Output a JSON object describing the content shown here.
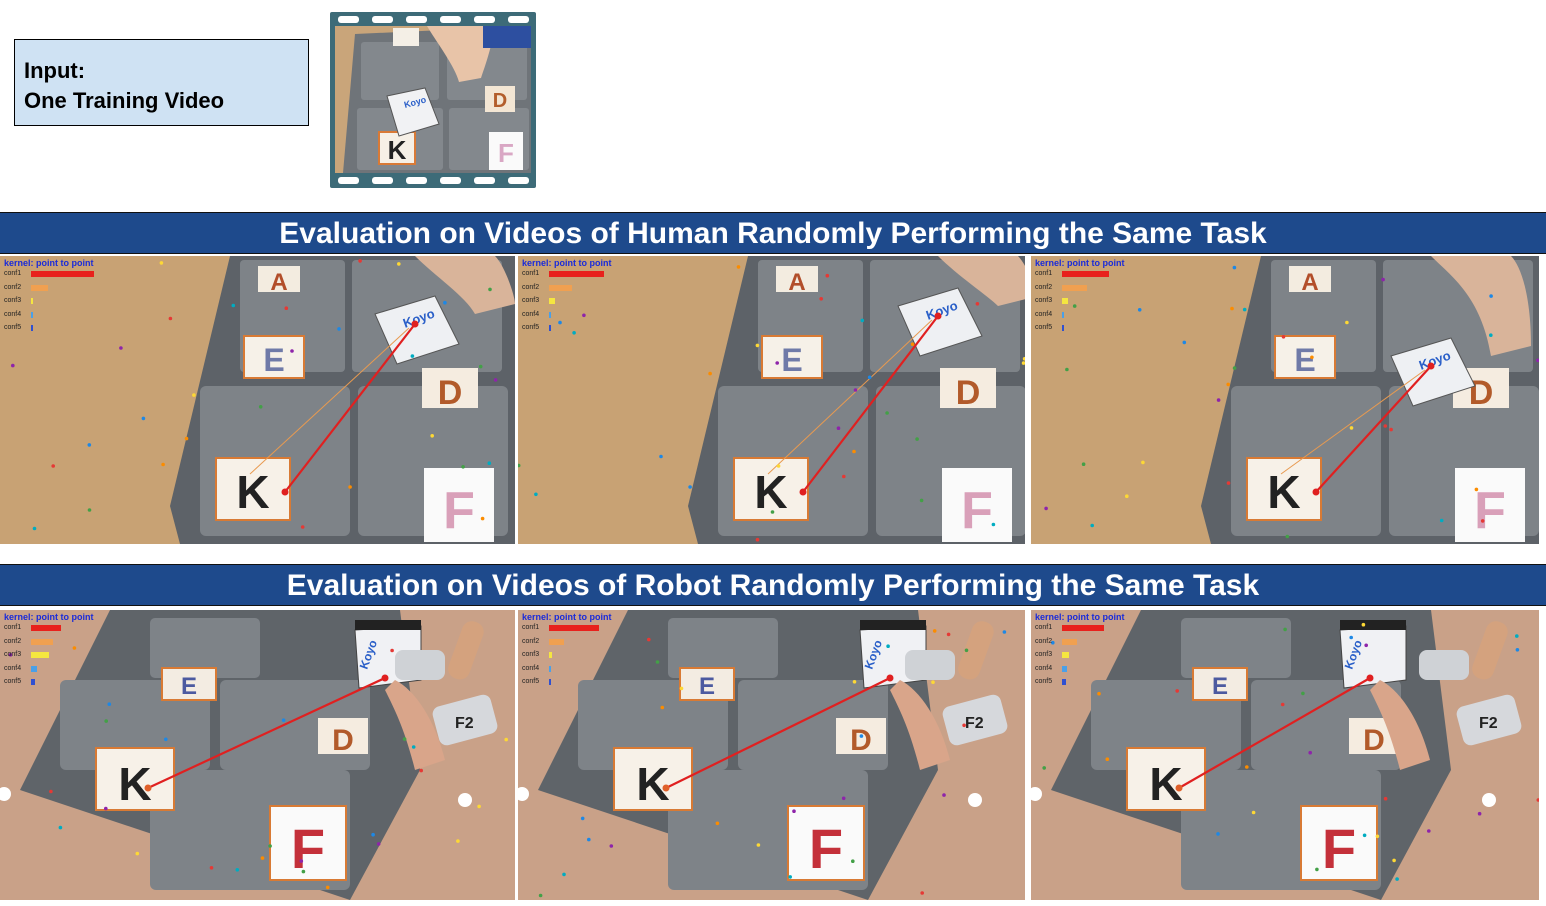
{
  "input_box": {
    "line1": "Input:",
    "line2": "One Training Video"
  },
  "banners": {
    "human": "Evaluation on Videos of Human Randomly Performing the Same Task",
    "robot": "Evaluation on Videos of Robot Randomly Performing the Same Task"
  },
  "kernel_label": "kernel: point to point",
  "confidence_labels": [
    "conf1",
    "conf2",
    "conf3",
    "conf4",
    "conf5"
  ],
  "bar_colors": [
    "#e8211c",
    "#f0a050",
    "#f5e640",
    "#4aa0e8",
    "#3050d0"
  ],
  "human_panels": [
    {
      "conf_fractions": [
        0.79,
        0.21,
        0.005,
        0.005,
        0.003
      ]
    },
    {
      "conf_fractions": [
        0.69,
        0.29,
        0.08,
        0.012,
        0.006
      ]
    },
    {
      "conf_fractions": [
        0.59,
        0.31,
        0.07,
        0.008,
        0.002
      ]
    }
  ],
  "robot_panels": [
    {
      "conf_fractions": [
        0.38,
        0.27,
        0.22,
        0.07,
        0.05
      ]
    },
    {
      "conf_fractions": [
        0.62,
        0.19,
        0.04,
        0.03,
        0.01
      ]
    },
    {
      "conf_fractions": [
        0.53,
        0.19,
        0.09,
        0.06,
        0.05
      ]
    }
  ],
  "card_letters": [
    "A",
    "E",
    "D",
    "K",
    "F"
  ],
  "object_label": "Koyo",
  "gripper_label": "F2"
}
